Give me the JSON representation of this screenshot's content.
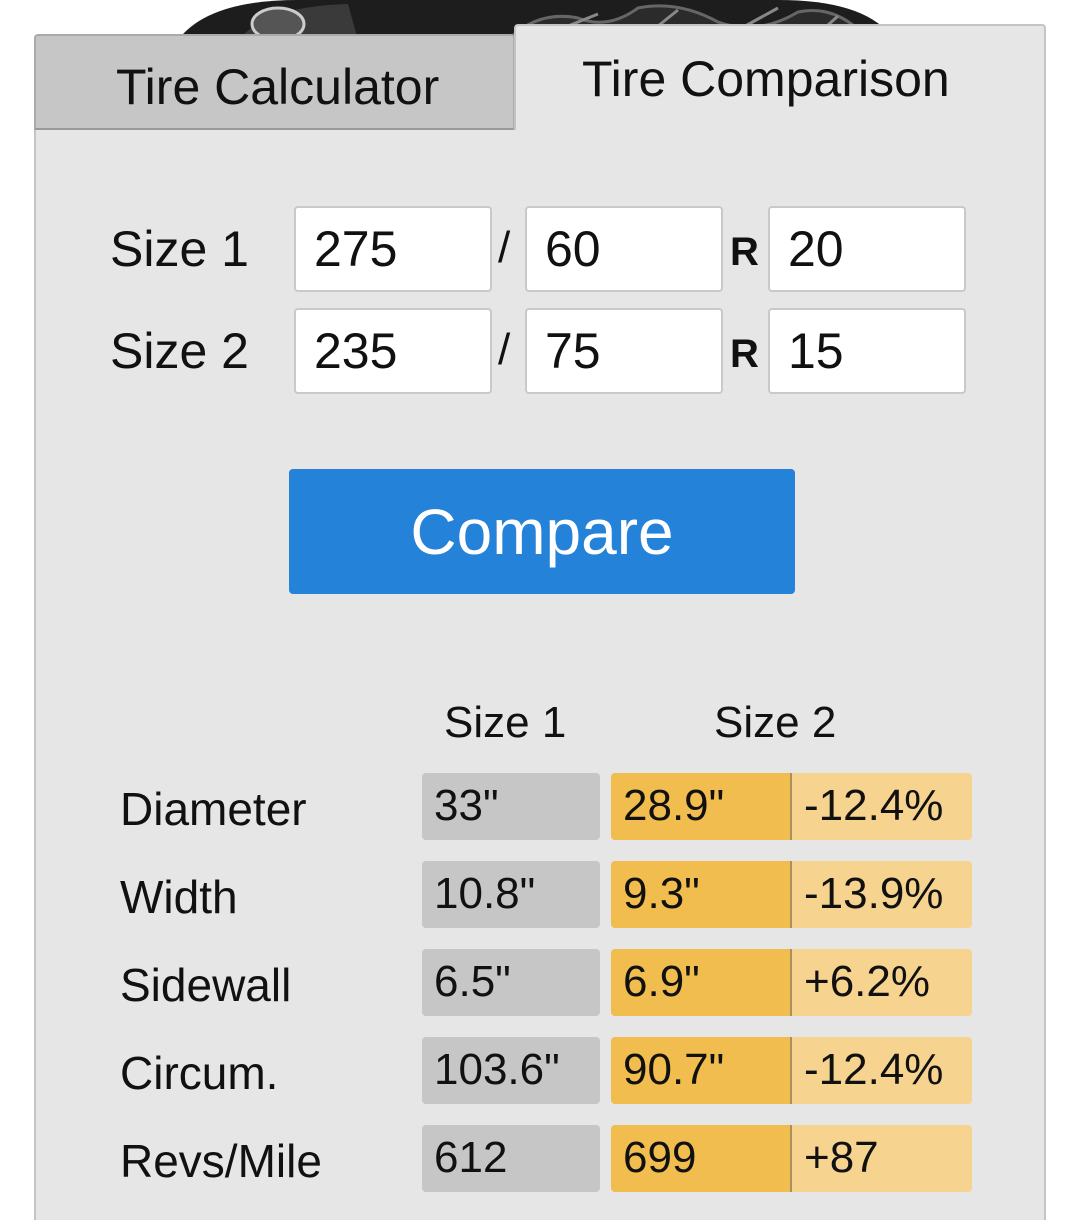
{
  "tabs": {
    "calculator": "Tire Calculator",
    "comparison": "Tire Comparison"
  },
  "inputs": {
    "size1": {
      "label": "Size 1",
      "width": "275",
      "aspect": "60",
      "rim": "20"
    },
    "size2": {
      "label": "Size 2",
      "width": "235",
      "aspect": "75",
      "rim": "15"
    },
    "separator": "/",
    "r_label": "R"
  },
  "compare_button": "Compare",
  "results": {
    "headers": {
      "size1": "Size 1",
      "size2": "Size 2"
    },
    "rows": [
      {
        "label": "Diameter",
        "size1": "33\"",
        "size2": "28.9\"",
        "diff": "-12.4%"
      },
      {
        "label": "Width",
        "size1": "10.8\"",
        "size2": "9.3\"",
        "diff": "-13.9%"
      },
      {
        "label": "Sidewall",
        "size1": "6.5\"",
        "size2": "6.9\"",
        "diff": "+6.2%"
      },
      {
        "label": "Circum.",
        "size1": "103.6\"",
        "size2": "90.7\"",
        "diff": "-12.4%"
      },
      {
        "label": "Revs/Mile",
        "size1": "612",
        "size2": "699",
        "diff": "+87"
      }
    ]
  },
  "colors": {
    "button": "#2483d8",
    "size1_cell": "#c6c6c6",
    "size2_cell": "#f2bd4f",
    "diff_cell": "#f6d38e",
    "panel": "#e6e6e6"
  }
}
